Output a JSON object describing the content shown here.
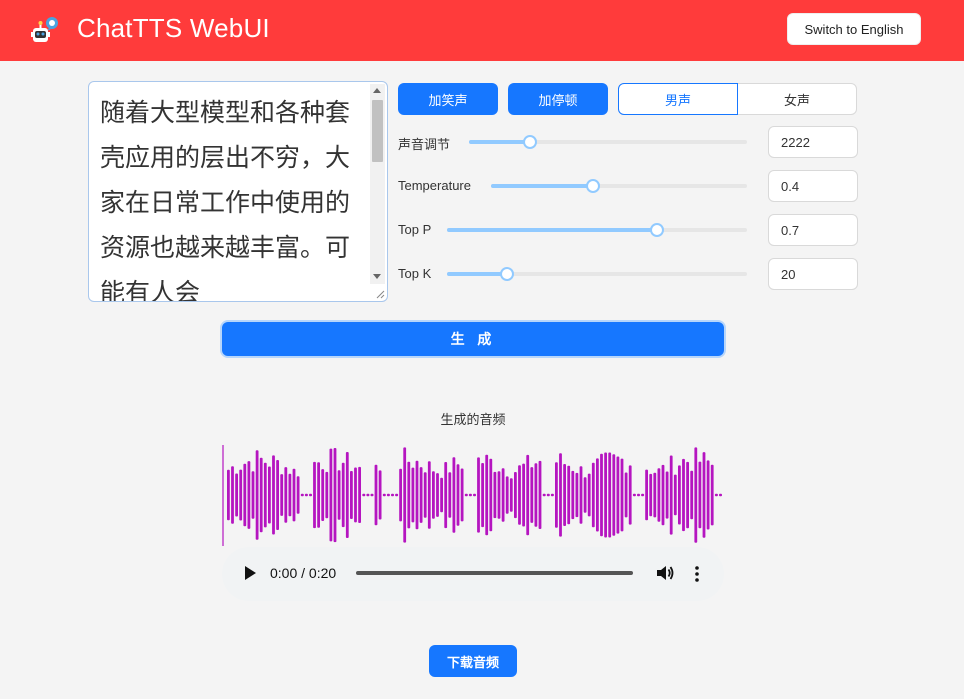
{
  "header": {
    "title": "ChatTTS WebUI",
    "logo_icon": "chat-robot-icon",
    "lang_button": "Switch to English",
    "background": "#ff3b3b"
  },
  "input": {
    "text": "随着大型模型和各种套壳应用的层出不穷，大家在日常工作中使用的资源也越来越丰富。可能有人会"
  },
  "buttons": {
    "laugh": "加笑声",
    "pause": "加停顿",
    "generate": "生 成",
    "download": "下载音频"
  },
  "voice_gender": {
    "options": [
      "男声",
      "女声"
    ],
    "selected": "男声"
  },
  "sliders": [
    {
      "label": "声音调节",
      "value": "2222",
      "fraction": 0.22
    },
    {
      "label": "Temperature",
      "value": "0.4",
      "fraction": 0.4
    },
    {
      "label": "Top P",
      "value": "0.7",
      "fraction": 0.7
    },
    {
      "label": "Top K",
      "value": "20",
      "fraction": 0.2
    }
  ],
  "audio": {
    "label": "生成的音频",
    "time": "0:00 / 0:20",
    "waveform_color": "#b515c0",
    "accent": "#1677ff"
  }
}
